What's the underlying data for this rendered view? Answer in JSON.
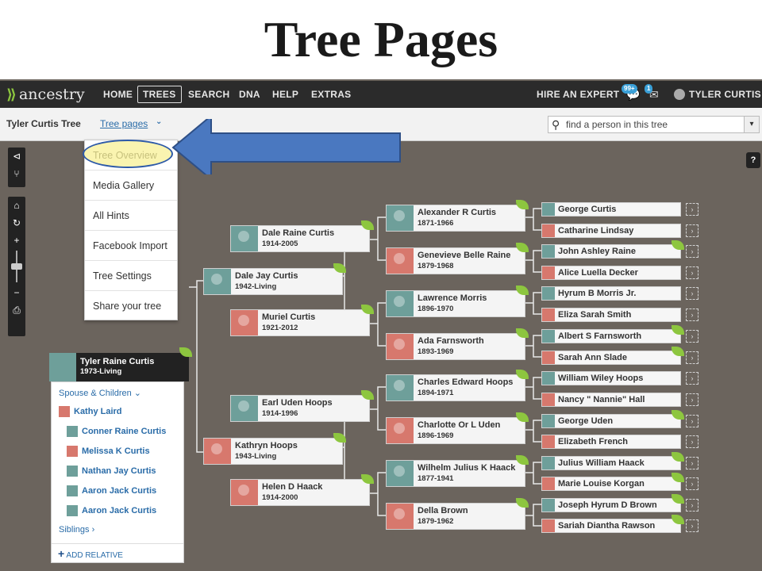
{
  "slide": {
    "title": "Tree Pages"
  },
  "nav": {
    "logo": "ancestry",
    "items": [
      "HOME",
      "TREES",
      "SEARCH",
      "DNA",
      "HELP",
      "EXTRAS"
    ],
    "hire": "HIRE AN EXPERT",
    "badge_hints": "99+",
    "badge_messages": "1",
    "user": "TYLER CURTIS"
  },
  "subheader": {
    "tree_name": "Tyler Curtis Tree",
    "tree_pages": "Tree pages",
    "search_placeholder": "find a person in this tree"
  },
  "menu": {
    "items": [
      "Tree Overview",
      "Media Gallery",
      "All Hints",
      "Facebook Import",
      "Tree Settings",
      "Share your tree"
    ]
  },
  "root": {
    "name": "Tyler Raine Curtis",
    "dates": "1973-Living"
  },
  "family": {
    "spouse_header": "Spouse & Children",
    "members": [
      {
        "name": "Kathy Laird",
        "gender": "f"
      },
      {
        "name": "Conner Raine Curtis",
        "gender": "m"
      },
      {
        "name": "Melissa K Curtis",
        "gender": "f"
      },
      {
        "name": "Nathan Jay Curtis",
        "gender": "m"
      },
      {
        "name": "Aaron Jack Curtis",
        "gender": "m"
      },
      {
        "name": "Aaron Jack Curtis",
        "gender": "m"
      }
    ],
    "siblings": "Siblings",
    "add_relative": "ADD RELATIVE"
  },
  "parents": {
    "father": {
      "name": "Dale Jay Curtis",
      "dates": "1942-Living"
    },
    "mother": {
      "name": "Kathryn Hoops",
      "dates": "1943-Living"
    }
  },
  "grandparents": [
    {
      "name": "Dale Raine Curtis",
      "dates": "1914-2005"
    },
    {
      "name": "Muriel Curtis",
      "dates": "1921-2012"
    },
    {
      "name": "Earl Uden Hoops",
      "dates": "1914-1996"
    },
    {
      "name": "Helen D Haack",
      "dates": "1914-2000"
    }
  ],
  "great_grandparents": [
    {
      "name": "Alexander R Curtis",
      "dates": "1871-1966"
    },
    {
      "name": "Genevieve Belle Raine",
      "dates": "1879-1968"
    },
    {
      "name": "Lawrence Morris",
      "dates": "1896-1970"
    },
    {
      "name": "Ada Farnsworth",
      "dates": "1893-1969"
    },
    {
      "name": "Charles Edward Hoops",
      "dates": "1894-1971"
    },
    {
      "name": "Charlotte Or L Uden",
      "dates": "1896-1969"
    },
    {
      "name": "Wilhelm Julius K Haack",
      "dates": "1877-1941"
    },
    {
      "name": "Della Brown",
      "dates": "1879-1962"
    }
  ],
  "gg_grandparents": [
    "George Curtis",
    "Catharine Lindsay",
    "John Ashley Raine",
    "Alice Luella Decker",
    "Hyrum B Morris Jr.",
    "Eliza Sarah Smith",
    "Albert S Farnsworth",
    "Sarah Ann Slade",
    "William Wiley Hoops",
    "Nancy \" Nannie\" Hall",
    "George Uden",
    "Elizabeth French",
    "Julius William Haack",
    "Marie Louise Korgan",
    "Joseph Hyrum D Brown",
    "Sariah Diantha Rawson"
  ],
  "colors": {
    "male": "#6e9f9a",
    "female": "#d7786d",
    "hint_leaf": "#8dc63f",
    "arrow": "#4a78c0"
  }
}
